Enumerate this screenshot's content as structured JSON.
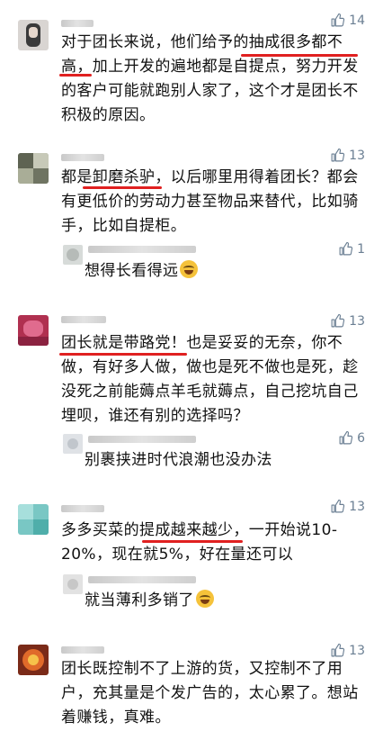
{
  "comments": [
    {
      "likes": "14",
      "text": "对于团长来说，他们给予的抽成很多都不高，加上开发的遍地都是自提点，努力开发的客户可能就跑别人家了，这个才是团长不积极的原因。"
    },
    {
      "likes": "13",
      "text": "都是卸磨杀驴，以后哪里用得着团长？都会有更低价的劳动力甚至物品来替代，比如骑手，比如自提柜。",
      "reply": {
        "likes": "1",
        "text": "想得长看得远"
      }
    },
    {
      "likes": "13",
      "text": "团长就是带路党！也是妥妥的无奈，你不做，有好多人做，做也是死不做也是死，趁没死之前能薅点羊毛就薅点，自己挖坑自己埋呗，谁还有别的选择吗？",
      "reply": {
        "likes": "6",
        "text": "别裹挟进时代浪潮也没办法"
      }
    },
    {
      "likes": "13",
      "text": "多多买菜的提成越来越少，一开始说10-20%，现在就5%，好在量还可以",
      "reply": {
        "likes": "",
        "text": "就当薄利多销了"
      }
    },
    {
      "likes": "13",
      "text": "团长既控制不了上游的货，又控制不了用户，充其量是个发广告的，太心累了。想站着赚钱，真难。"
    }
  ],
  "icons": {
    "like": "thumbs-up-icon",
    "emoji": "laugh-cry-emoji-icon"
  },
  "colors": {
    "highlight": "#e02020",
    "like": "#6b7f93"
  }
}
